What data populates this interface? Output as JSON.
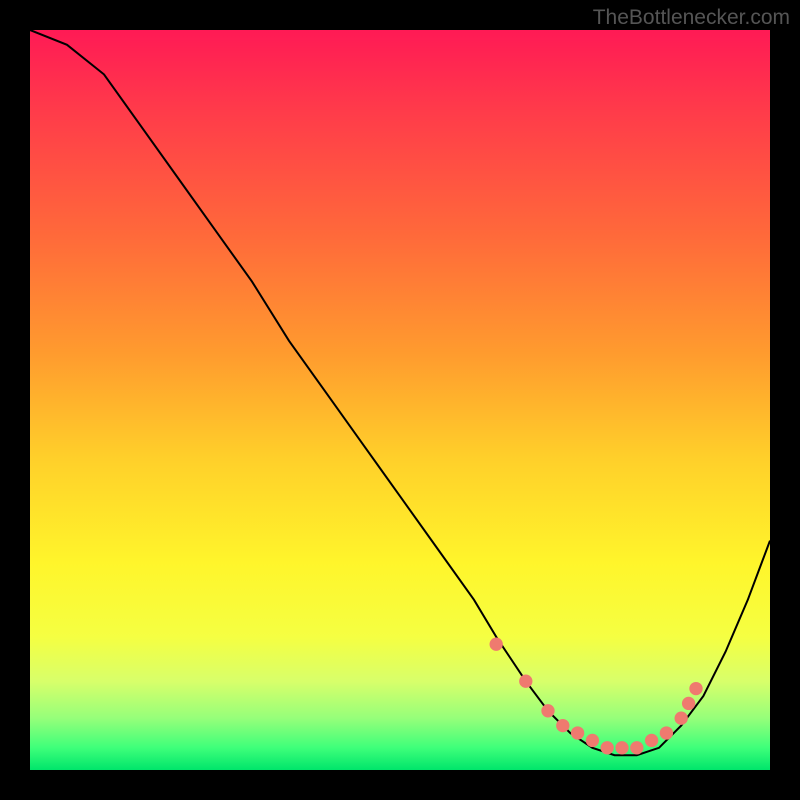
{
  "watermark": "TheBottlenecker.com",
  "chart_data": {
    "type": "line",
    "title": "",
    "xlabel": "",
    "ylabel": "",
    "xlim": [
      0,
      100
    ],
    "ylim": [
      0,
      100
    ],
    "series": [
      {
        "name": "curve",
        "x": [
          0,
          5,
          10,
          15,
          20,
          25,
          30,
          35,
          40,
          45,
          50,
          55,
          60,
          63,
          67,
          70,
          73,
          76,
          79,
          82,
          85,
          88,
          91,
          94,
          97,
          100
        ],
        "y": [
          100,
          98,
          94,
          87,
          80,
          73,
          66,
          58,
          51,
          44,
          37,
          30,
          23,
          18,
          12,
          8,
          5,
          3,
          2,
          2,
          3,
          6,
          10,
          16,
          23,
          31
        ]
      }
    ],
    "highlight_dots": {
      "x": [
        63,
        67,
        70,
        72,
        74,
        76,
        78,
        80,
        82,
        84,
        86,
        88,
        89,
        90
      ],
      "y": [
        17,
        12,
        8,
        6,
        5,
        4,
        3,
        3,
        3,
        4,
        5,
        7,
        9,
        11
      ]
    },
    "colors": {
      "curve": "#000000",
      "dots": "#ef7a6f",
      "gradient_top": "#ff1a55",
      "gradient_bottom": "#00e56b"
    }
  }
}
